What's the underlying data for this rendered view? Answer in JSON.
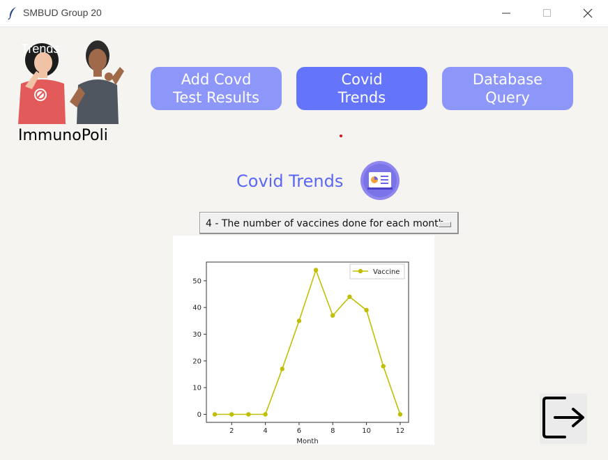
{
  "window": {
    "title": "SMBUD Group 20",
    "icon": "feather-icon"
  },
  "brand": {
    "name": "ImmunoPoli",
    "faded_label": "Trends"
  },
  "nav": {
    "add_line1": "Add Covd",
    "add_line2": "Test Results",
    "trends_line1": "Covid",
    "trends_line2": "Trends",
    "query_line1": "Database",
    "query_line2": "Query"
  },
  "section": {
    "title": "Covid Trends",
    "icon": "presentation-chart-icon"
  },
  "dropdown": {
    "selected": "4 - The number of vaccines done for each month"
  },
  "logout": {
    "icon": "logout-icon"
  },
  "colors": {
    "nav_active": "#6575fb",
    "nav_inactive": "#8d96f9",
    "accent_text": "#5a67f5",
    "series": "#bfbf00"
  },
  "chart_data": {
    "type": "line",
    "xlabel": "Month",
    "ylabel": "",
    "xlim": [
      0.5,
      12.5
    ],
    "ylim": [
      -3,
      57
    ],
    "xticks": [
      "2",
      "4",
      "6",
      "8",
      "10",
      "12"
    ],
    "yticks": [
      "0",
      "10",
      "20",
      "30",
      "40",
      "50"
    ],
    "legend_position": "top-right",
    "grid": false,
    "series": [
      {
        "name": "Vaccine",
        "x": [
          1,
          2,
          3,
          4,
          5,
          6,
          7,
          8,
          9,
          10,
          11,
          12
        ],
        "values": [
          0,
          0,
          0,
          0,
          17,
          35,
          54,
          37,
          44,
          39,
          18,
          0
        ]
      }
    ]
  }
}
